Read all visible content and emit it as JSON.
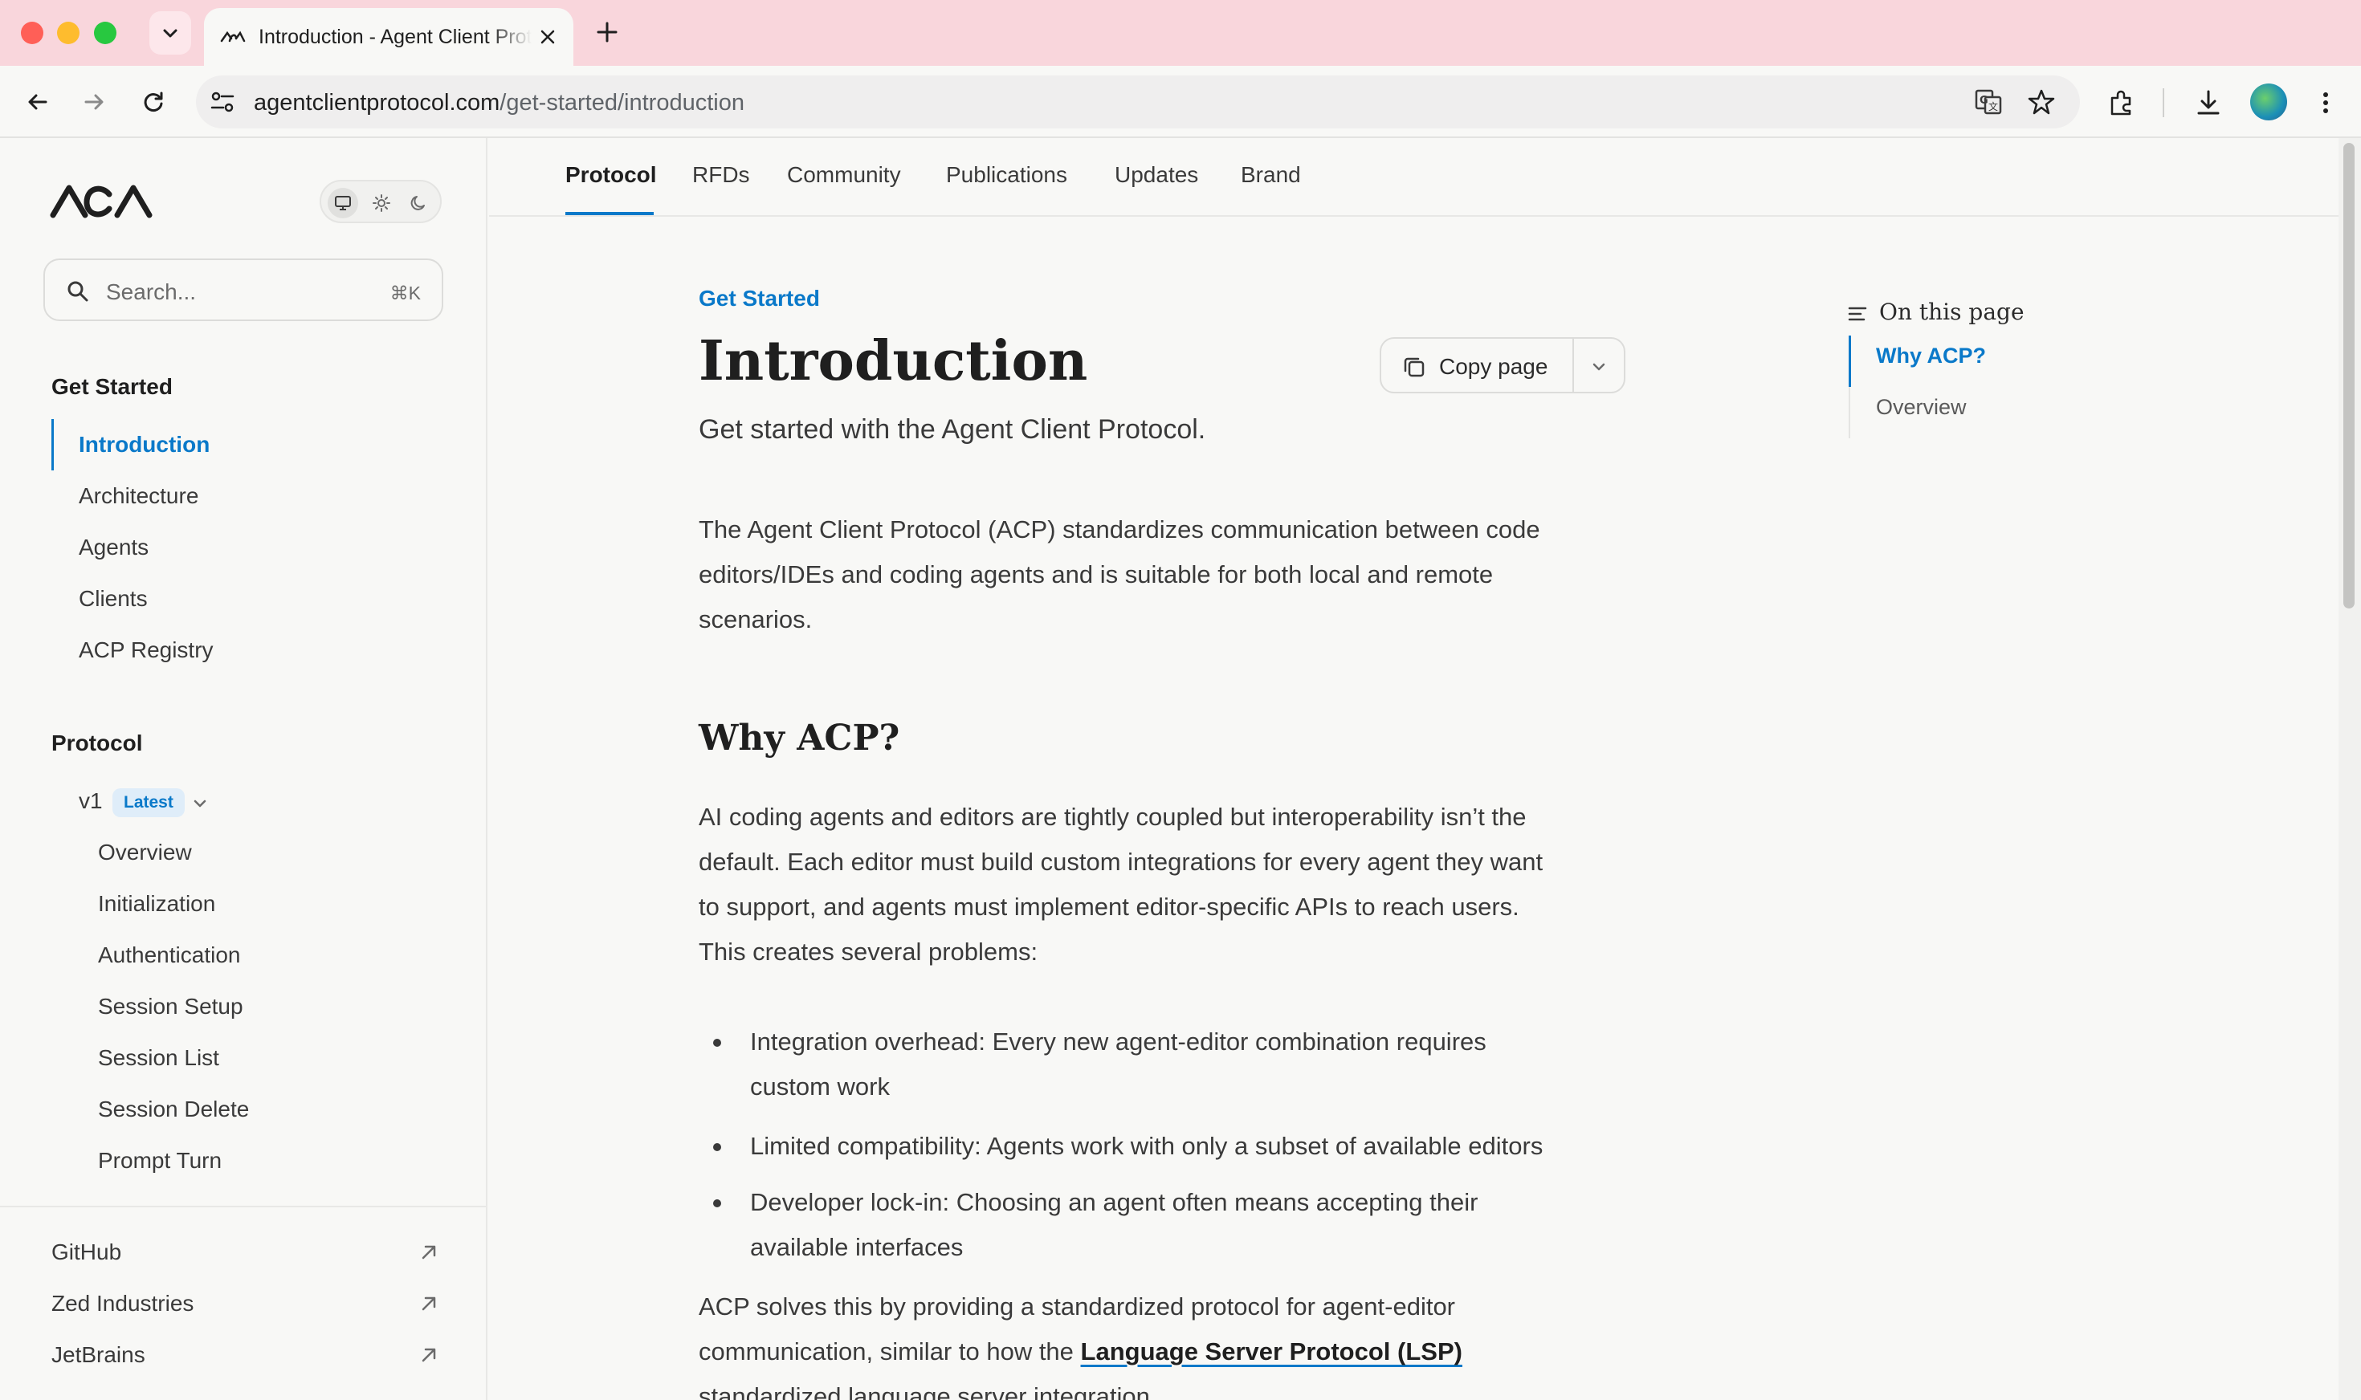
{
  "browser": {
    "tab_title": "Introduction - Agent Client Protocol",
    "url_domain": "agentclientprotocol.com",
    "url_path": "/get-started/introduction"
  },
  "sidebar": {
    "search_placeholder": "Search...",
    "search_shortcut": "⌘K",
    "sections": [
      {
        "heading": "Get Started",
        "items": [
          "Introduction",
          "Architecture",
          "Agents",
          "Clients",
          "ACP Registry"
        ],
        "active": "Introduction"
      },
      {
        "heading": "Protocol",
        "version": "v1",
        "version_badge": "Latest",
        "items": [
          "Overview",
          "Initialization",
          "Authentication",
          "Session Setup",
          "Session List",
          "Session Delete",
          "Prompt Turn"
        ]
      }
    ],
    "external_links": [
      "GitHub",
      "Zed Industries",
      "JetBrains"
    ]
  },
  "topnav": {
    "items": [
      "Protocol",
      "RFDs",
      "Community",
      "Publications",
      "Updates",
      "Brand"
    ],
    "active": "Protocol"
  },
  "content": {
    "eyebrow": "Get Started",
    "title": "Introduction",
    "copy_button": "Copy page",
    "subtitle": "Get started with the Agent Client Protocol.",
    "intro_lines": [
      "The Agent Client Protocol (ACP) standardizes communication between code",
      "editors/IDEs and coding agents and is suitable for both local and remote",
      "scenarios."
    ],
    "why_heading": "Why ACP?",
    "why_lines": [
      "AI coding agents and editors are tightly coupled but interoperability isn’t the",
      "default. Each editor must build custom integrations for every agent they want",
      "to support, and agents must implement editor-specific APIs to reach users.",
      "This creates several problems:"
    ],
    "bullets": [
      [
        "Integration overhead: Every new agent-editor combination requires",
        "custom work"
      ],
      [
        "Limited compatibility: Agents work with only a subset of available editors"
      ],
      [
        "Developer lock-in: Choosing an agent often means accepting their",
        "available interfaces"
      ]
    ],
    "solution_line1": "ACP solves this by providing a standardized protocol for agent-editor",
    "solution_line2_prefix": "communication, similar to how the ",
    "solution_link": "Language Server Protocol (LSP)",
    "solution_line3": "standardized language server integration."
  },
  "toc": {
    "title": "On this page",
    "items": [
      "Why ACP?",
      "Overview"
    ],
    "active": "Why ACP?"
  },
  "colors": {
    "accent": "#0a79c9",
    "tabbar": "#f9d6dc",
    "page_bg": "#f8f8f6"
  }
}
